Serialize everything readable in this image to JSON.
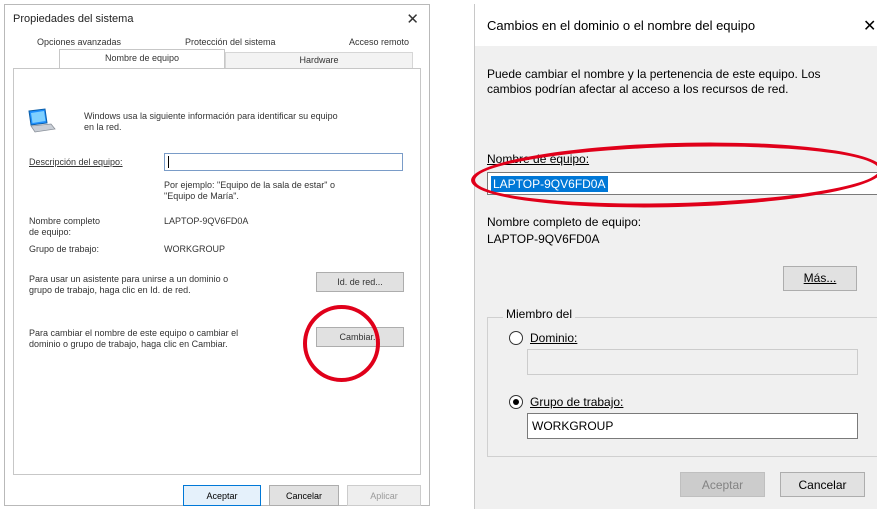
{
  "left": {
    "title": "Propiedades del sistema",
    "close": "✕",
    "tabs_row1": [
      "Opciones avanzadas",
      "Protección del sistema",
      "Acceso remoto"
    ],
    "tab_active": "Nombre de equipo",
    "tab_hardware": "Hardware",
    "info_line1": "Windows usa la siguiente información para identificar su equipo",
    "info_line2": "en la red.",
    "desc_label": "Descripción del equipo:",
    "desc_value": "",
    "example_line1": "Por ejemplo: \"Equipo de la sala de estar\" o",
    "example_line2": "\"Equipo de María\".",
    "fullname_label1": "Nombre completo",
    "fullname_label2": "de equipo:",
    "fullname_value": "LAPTOP-9QV6FD0A",
    "workgroup_label": "Grupo de trabajo:",
    "workgroup_value": "WORKGROUP",
    "wizard_line1": "Para usar un asistente para unirse a un dominio o",
    "wizard_line2": "grupo de trabajo, haga clic en Id. de red.",
    "netid_button": "Id. de red...",
    "change_line1": "Para cambiar el nombre de este equipo o cambiar el",
    "change_line2": "dominio o grupo de trabajo, haga clic en Cambiar.",
    "change_button": "Cambiar...",
    "ok_button": "Aceptar",
    "cancel_button": "Cancelar",
    "apply_button": "Aplicar"
  },
  "right": {
    "title": "Cambios en el dominio o el nombre del equipo",
    "close": "✕",
    "desc_line1": "Puede cambiar el nombre y la pertenencia de este equipo. Los",
    "desc_line2": "cambios podrían afectar al acceso a los recursos de red.",
    "name_label": "Nombre de equipo:",
    "name_value": "LAPTOP-9QV6FD0A",
    "fullname_label": "Nombre completo de equipo:",
    "fullname_value": "LAPTOP-9QV6FD0A",
    "more_button": "Más...",
    "member_legend": "Miembro del",
    "domain_label": "Dominio:",
    "domain_value": "",
    "workgroup_label": "Grupo de trabajo:",
    "workgroup_value": "WORKGROUP",
    "accept_button": "Aceptar",
    "cancel_button": "Cancelar"
  },
  "colors": {
    "highlight": "#e0001a",
    "selection": "#0078d7"
  }
}
